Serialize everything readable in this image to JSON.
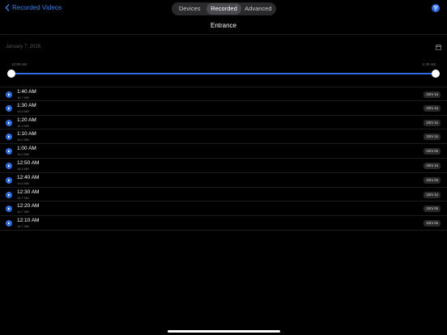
{
  "nav": {
    "back_label": "Recorded Videos"
  },
  "tabs": [
    {
      "label": "Devices",
      "active": false
    },
    {
      "label": "Recorded",
      "active": true
    },
    {
      "label": "Advanced",
      "active": false
    }
  ],
  "page": {
    "title": "Entrance"
  },
  "date": {
    "label": "January 7, 2026"
  },
  "range": {
    "start_label": "12:00 AM",
    "end_label": "1:40 AM"
  },
  "recordings": [
    {
      "time": "1:40 AM",
      "size": "16.7 MB",
      "duration": "10m 1s"
    },
    {
      "time": "1:30 AM",
      "size": "16.8 MB",
      "duration": "10m 1s"
    },
    {
      "time": "1:20 AM",
      "size": "16.3 MB",
      "duration": "10m 1s"
    },
    {
      "time": "1:10 AM",
      "size": "16.2 MB",
      "duration": "10m 1s"
    },
    {
      "time": "1:00 AM",
      "size": "16.3 MB",
      "duration": "10m 0s"
    },
    {
      "time": "12:50 AM",
      "size": "16.5 MB",
      "duration": "10m 1s"
    },
    {
      "time": "12:40 AM",
      "size": "15.8 MB",
      "duration": "10m 0s"
    },
    {
      "time": "12:30 AM",
      "size": "16.7 MB",
      "duration": "10m 1s"
    },
    {
      "time": "12:20 AM",
      "size": "16.7 MB",
      "duration": "10m 0s"
    },
    {
      "time": "12:10 AM",
      "size": "16.7 MB",
      "duration": "10m 0s"
    }
  ],
  "colors": {
    "accent": "#2f6be0",
    "background": "#000000"
  }
}
